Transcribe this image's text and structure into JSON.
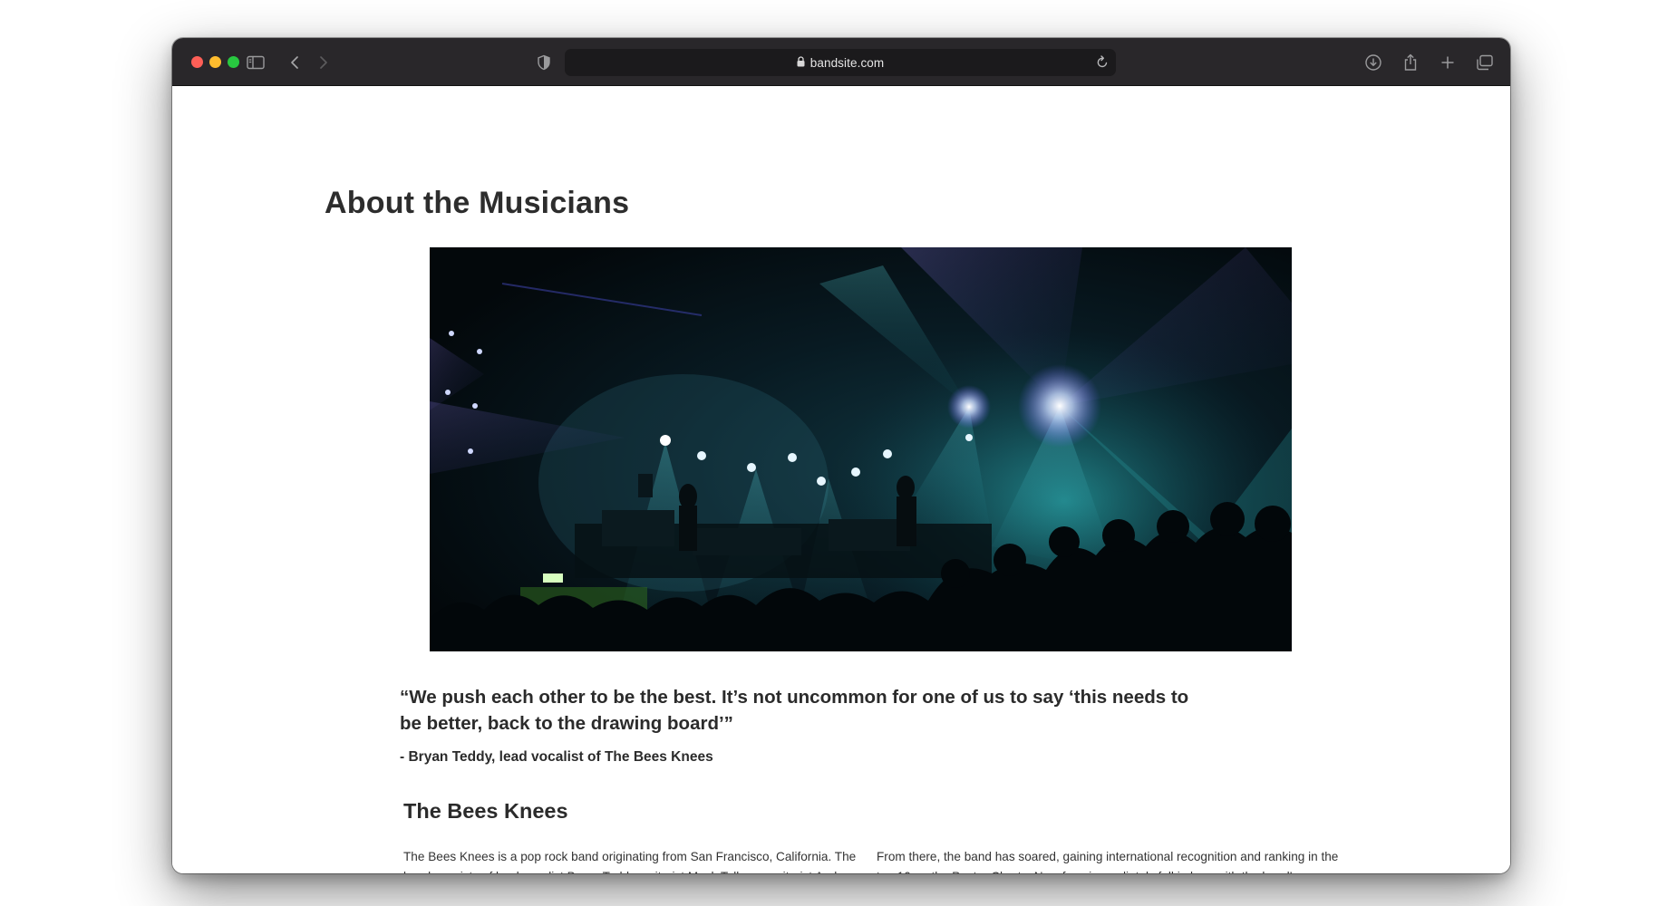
{
  "browser": {
    "url": "bandsite.com"
  },
  "page": {
    "title": "About the Musicians",
    "hero_image_alt": "Concert stage with spotlights and crowd",
    "quote": "“We push each other to be the best. It’s not uncommon for one of us to say ‘this needs to be better, back to the drawing board’”",
    "attribution": "- Bryan Teddy, lead vocalist of The Bees Knees",
    "section_title": "The Bees Knees",
    "paragraph_left": "The Bees Knees is a pop rock band originating from San Francisco, California. The band consists of lead vocalist Bryan Teddy, guitarist Mack Tolkens, guitarist Andrew Green, bassist Kent Zulkee and drummer Freddie Fischer. The band achieved its first commercial success as an unsigned act, drawing attention from",
    "paragraph_right": "From there, the band has soared, gaining international recognition and ranking in the top 10 on the Poster Charts. New fans immediately fell in love with the band’s original and organic attitude, solidifying their place as one of the hottest and fastest up and coming acts of this century. Fans affectionately refer to"
  },
  "colors": {
    "toolbar": "#29272a",
    "address_bar": "#1b1a1c",
    "close": "#fe5f57",
    "minimize": "#febc2e",
    "zoom": "#28c840",
    "text": "#2b2b2b"
  },
  "icons": [
    "sidebar-icon",
    "back-icon",
    "forward-icon",
    "shield-icon",
    "lock-icon",
    "reload-icon",
    "download-icon",
    "share-icon",
    "new-tab-icon",
    "tabs-overview-icon"
  ]
}
